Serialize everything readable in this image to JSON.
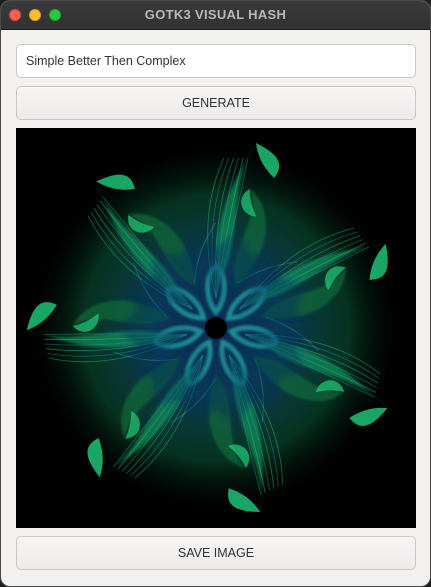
{
  "window": {
    "title": "GOTK3 VISUAL HASH"
  },
  "input": {
    "value": "Simple Better Then Complex"
  },
  "buttons": {
    "generate_label": "GENERATE",
    "save_label": "SAVE IMAGE"
  },
  "image": {
    "description_icon": "visual-hash-mandala",
    "background": "#000000",
    "colors": [
      "#0b6b3a",
      "#13a86a",
      "#1fd07e",
      "#1d9fa0",
      "#1a6fa0",
      "#0d2f5c"
    ],
    "symmetry": 7
  }
}
